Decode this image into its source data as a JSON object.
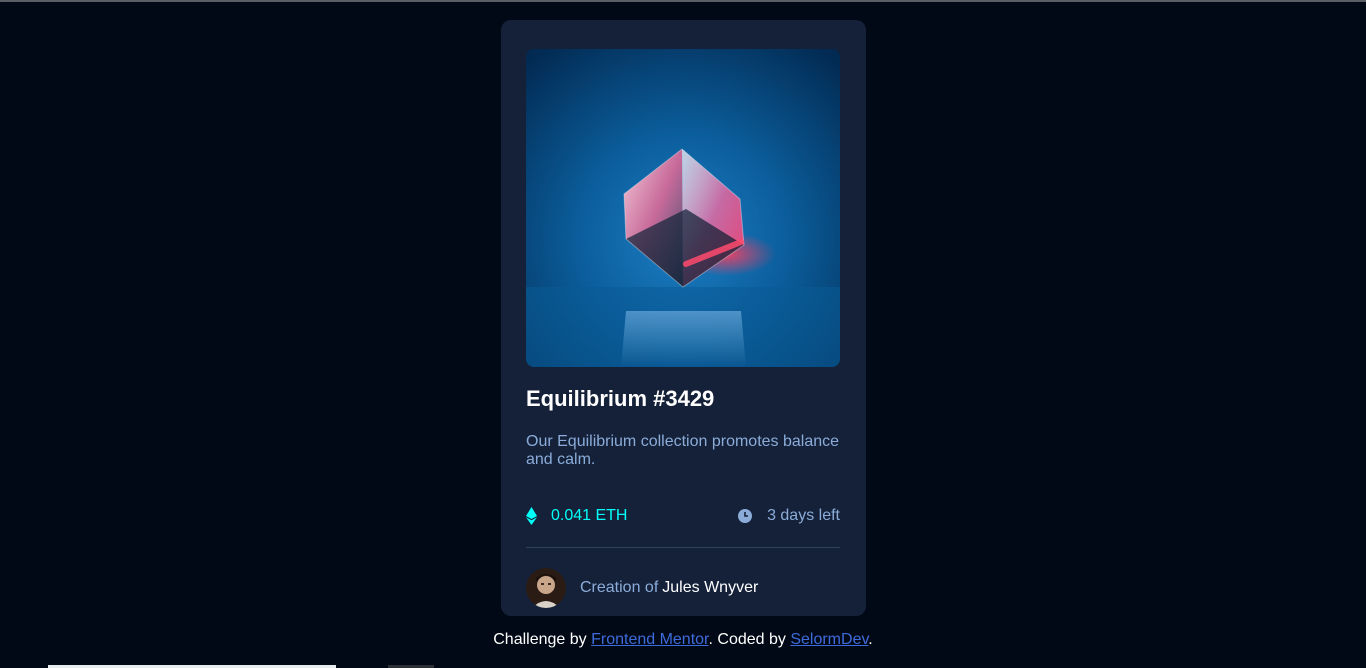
{
  "card": {
    "image_alt": "Equilibrium image",
    "title": "Equilibrium #3429",
    "description": "Our Equilibrium collection promotes balance and calm.",
    "price": "0.041 ETH",
    "time_left": "3 days left",
    "creator_prefix": "Creation of",
    "creator_name": "Jules Wnyver"
  },
  "attribution": {
    "prefix": "Challenge by ",
    "link1": "Frontend Mentor",
    "middle": ". Coded by ",
    "link2": "SelormDev",
    "suffix": "."
  },
  "colors": {
    "page_bg": "#000915",
    "card_bg": "#142139",
    "cyan": "#00fff8",
    "soft_blue": "#8bacd9",
    "white": "#ffffff"
  },
  "icons": {
    "price": "ethereum-icon",
    "time": "clock-icon"
  }
}
